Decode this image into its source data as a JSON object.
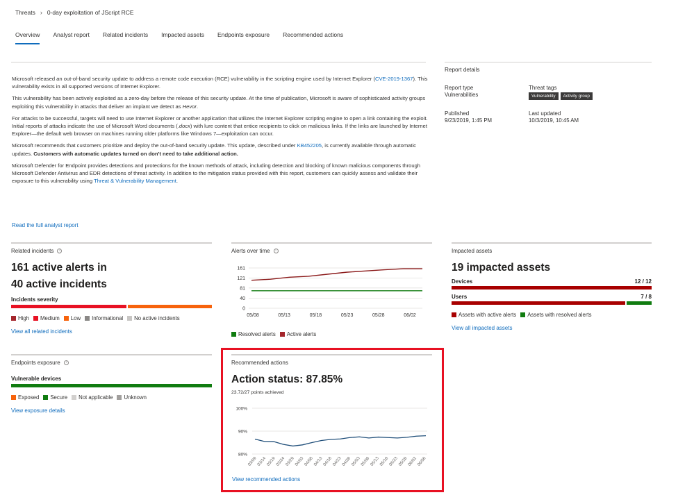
{
  "breadcrumb": {
    "root": "Threats",
    "current": "0-day exploitation of JScript RCE"
  },
  "tabs": [
    {
      "label": "Overview",
      "active": true
    },
    {
      "label": "Analyst report"
    },
    {
      "label": "Related incidents"
    },
    {
      "label": "Impacted assets"
    },
    {
      "label": "Endpoints exposure"
    },
    {
      "label": "Recommended actions"
    }
  ],
  "overview": {
    "p1_text": "Microsoft released an out-of-band security update to address a remote code execution (RCE) vulnerability in the scripting engine used by Internet Explorer (",
    "p1_link": "CVE-2019-1367",
    "p1_tail": "). This vulnerability exists in all supported versions of Internet Explorer.",
    "p2_text": "This vulnerability has been actively exploited as a zero-day before the release of this security update. At the time of publication, Microsoft is aware of sophisticated activity groups exploiting this vulnerability in attacks that deliver an implant we detect as ",
    "p2_em": "Hevor",
    "p2_tail": ".",
    "p3_text": "For attacks to be successful, targets will need to use Internet Explorer or another application that utilizes the Internet Explorer scripting engine to open a link containing the exploit. Initial reports of attacks indicate the use of Microsoft Word documents (",
    "p3_em": ".docx",
    "p3_tail": ") with lure content that entice recipients to click on malicious links. If the links are launched by Internet Explorer—the default web browser on machines running older platforms like Windows 7—exploitation can occur.",
    "p4_text": "Microsoft recommends that customers prioritize and deploy the out-of-band security update. This update, described under ",
    "p4_link": "KB452205",
    "p4_mid": ", is currently available through automatic updates. ",
    "p4_bold": "Customers with automatic updates turned on don't need to take additional action.",
    "p5_text": "Microsoft Defender for Endpoint provides detections and protections for the known methods of attack, including detection and blocking of known malicious components through Microsoft Defender Antivirus and EDR detections of threat activity. In addition to the mitigation status provided with this report, customers can quickly assess and validate their exposure to this vulnerability using ",
    "p5_link": "Threat & Vulnerability Management",
    "p5_tail": ".",
    "read_more": "Read the full analyst report"
  },
  "report_details": {
    "title": "Report details",
    "report_type_label": "Report type",
    "report_type_value": "Vulnerabilities",
    "threat_tags_label": "Threat tags",
    "tags": [
      "Vulnerability",
      "Activity group"
    ],
    "published_label": "Published",
    "published_value": "9/23/2019, 1:45 PM",
    "updated_label": "Last updated",
    "updated_value": "10/3/2019, 10:45 AM"
  },
  "related_incidents": {
    "title": "Related incidents",
    "headline_1": "161 active alerts in",
    "headline_2": "40 active incidents",
    "severity_label": "Incidents severity",
    "severity_bar": [
      0.58,
      0.42
    ],
    "legend": [
      {
        "label": "High",
        "color": "#a4262c"
      },
      {
        "label": "Medium",
        "color": "#e81123"
      },
      {
        "label": "Low",
        "color": "#f7630c"
      },
      {
        "label": "Informational",
        "color": "#8a8886"
      },
      {
        "label": "No active incidents",
        "color": "#c8c6c4"
      }
    ],
    "link": "View all related incidents"
  },
  "alerts_over_time": {
    "title": "Alerts over time",
    "legend": [
      {
        "label": "Resolved alerts",
        "color": "#107c10"
      },
      {
        "label": "Active alerts",
        "color": "#a4262c"
      }
    ]
  },
  "impacted_assets": {
    "title": "Impacted assets",
    "headline": "19 impacted assets",
    "devices_label": "Devices",
    "devices_count": "12 / 12",
    "devices_fraction": 1.0,
    "users_label": "Users",
    "users_count": "7 / 8",
    "users_fraction": 0.875,
    "legend": [
      {
        "label": "Assets with active alerts",
        "color": "#a80000"
      },
      {
        "label": "Assets with resolved alerts",
        "color": "#107c10"
      }
    ],
    "link": "View all impacted assets"
  },
  "endpoints_exposure": {
    "title": "Endpoints exposure",
    "vulnerable_label": "Vulnerable devices",
    "legend": [
      {
        "label": "Exposed",
        "color": "#f7630c"
      },
      {
        "label": "Secure",
        "color": "#107c10"
      },
      {
        "label": "Not applicable",
        "color": "#d2d0ce"
      },
      {
        "label": "Unknown",
        "color": "#a19f9d"
      }
    ],
    "link": "View exposure details"
  },
  "recommended_actions": {
    "title": "Recommended actions",
    "headline": "Action status: 87.85%",
    "points": "23.72/27 points achieved",
    "link": "View recommended actions"
  },
  "chart_data": [
    {
      "type": "line",
      "name": "alerts-over-time",
      "x": [
        "05/08",
        "05/13",
        "05/18",
        "05/23",
        "05/28",
        "06/02"
      ],
      "yticks": [
        0,
        40,
        81,
        121,
        161
      ],
      "ylim": [
        0,
        161
      ],
      "series": [
        {
          "name": "Active alerts",
          "color": "#8b1a1a",
          "values": [
            112,
            116,
            124,
            128,
            136,
            144,
            149,
            154,
            158,
            158
          ]
        },
        {
          "name": "Resolved alerts",
          "color": "#107c10",
          "values": [
            70,
            70,
            70,
            70,
            70,
            70,
            70,
            70,
            70,
            70
          ]
        }
      ],
      "grid": true
    },
    {
      "type": "line",
      "name": "action-status",
      "x": [
        "03/09",
        "03/14",
        "03/19",
        "03/24",
        "03/29",
        "04/03",
        "04/08",
        "04/13",
        "04/18",
        "04/23",
        "04/28",
        "05/03",
        "05/08",
        "05/13",
        "05/18",
        "05/23",
        "05/28",
        "06/02",
        "06/06"
      ],
      "yticks": [
        80,
        90,
        100
      ],
      "ylabels": [
        "80%",
        "90%",
        "100%"
      ],
      "ylim": [
        80,
        100
      ],
      "series": [
        {
          "name": "",
          "color": "#1f4e79",
          "values": [
            86.5,
            85.5,
            85.4,
            84.2,
            83.5,
            84.0,
            85.0,
            85.9,
            86.4,
            86.6,
            87.2,
            87.5,
            87.0,
            87.4,
            87.2,
            87.0,
            87.3,
            87.8,
            88.0
          ]
        }
      ],
      "grid": true
    }
  ]
}
